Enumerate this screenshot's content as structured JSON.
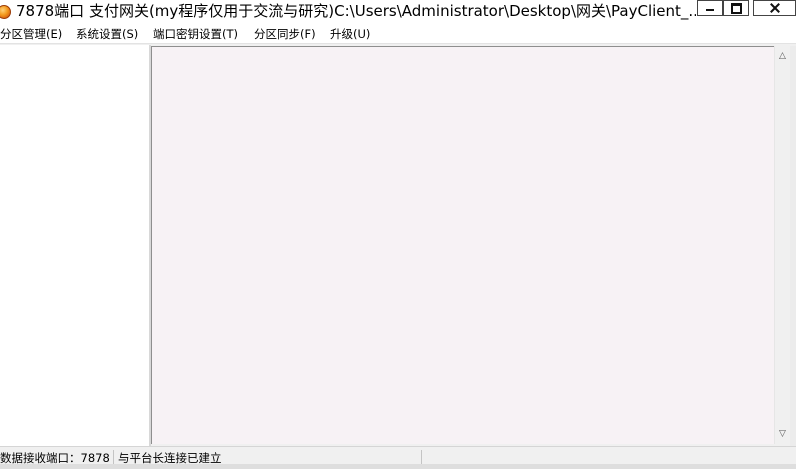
{
  "window": {
    "title": "7878端口 支付网关(my程序仅用于交流与研究)C:\\Users\\Administrator\\Desktop\\网关\\PayClient_..."
  },
  "menu": [
    {
      "label": "分区管理(E)"
    },
    {
      "label": "系统设置(S)"
    },
    {
      "label": "端口密钥设置(T)"
    },
    {
      "label": "分区同步(F)"
    },
    {
      "label": "升级(U)"
    }
  ],
  "status": {
    "port_label": "数据接收端口：7878",
    "connection_text": "与平台长连接已建立"
  },
  "icons": {
    "app": "app-orb-icon",
    "minimize": "minimize-icon",
    "maximize": "maximize-icon",
    "close": "close-icon",
    "scroll_up": "scroll-up-arrow-icon",
    "scroll_down": "scroll-down-arrow-icon"
  }
}
